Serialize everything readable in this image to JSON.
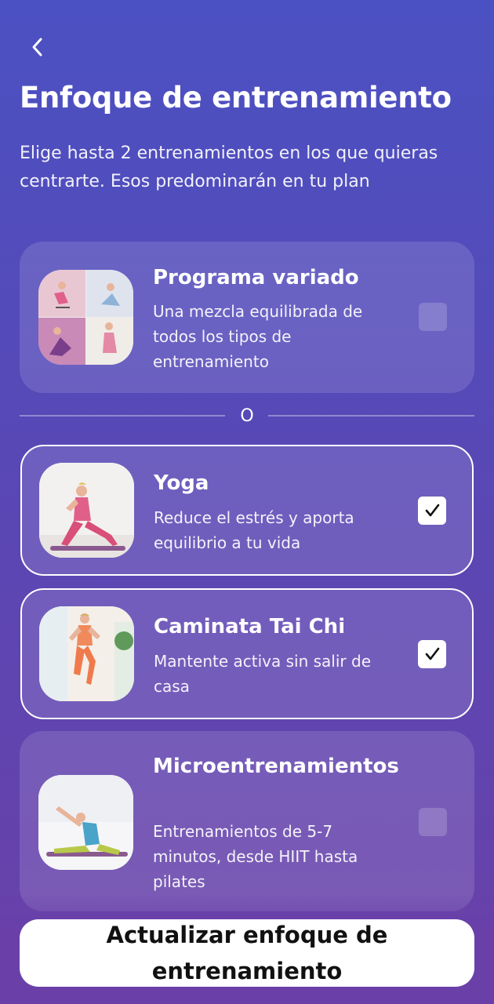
{
  "header": {
    "title": "Enfoque de entrenamiento",
    "subtitle": "Elige hasta 2 entrenamientos en los que quieras centrarte. Esos predominarán en tu plan"
  },
  "options": [
    {
      "title": "Programa variado",
      "description": "Una mezcla equilibrada de todos los tipos de entrenamiento",
      "checked": false,
      "thumb_icon": "collage-image"
    },
    {
      "title": "Yoga",
      "description": "Reduce el estrés y aporta equilibrio a tu vida",
      "checked": true,
      "thumb_icon": "yoga-pose-image"
    },
    {
      "title": "Caminata Tai Chi",
      "description": "Mantente activa sin salir de casa",
      "checked": true,
      "thumb_icon": "tai-chi-walk-image"
    },
    {
      "title": "Microentrenamientos",
      "description": "Entrenamientos de 5-7 minutos, desde HIIT hasta pilates",
      "checked": false,
      "thumb_icon": "stretch-pose-image"
    }
  ],
  "divider_label": "O",
  "cta_label": "Actualizar enfoque de entrenamiento",
  "colors": {
    "background_top": "#4b51c2",
    "background_bottom": "#6a40a8",
    "outfit_pink": "#e0608a"
  }
}
